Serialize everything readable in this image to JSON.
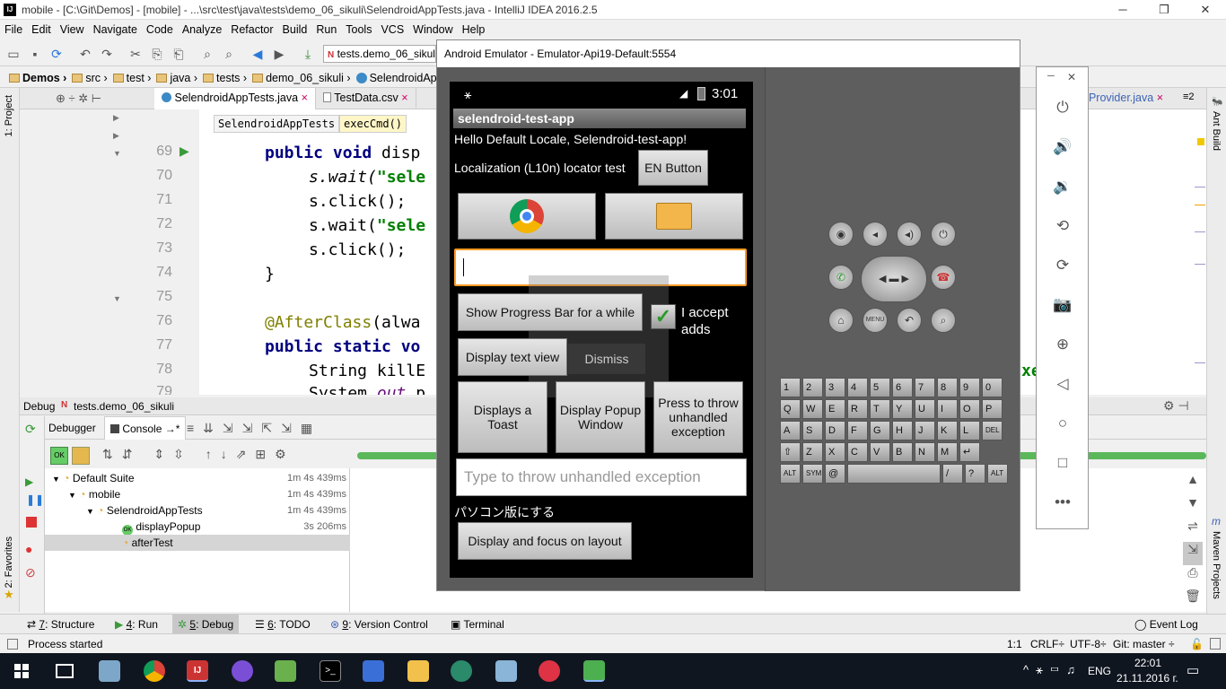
{
  "window": {
    "title": "mobile - [C:\\Git\\Demos] - [mobile] - ...\\src\\test\\java\\tests\\demo_06_sikuli\\SelendroidAppTests.java - IntelliJ IDEA 2016.2.5"
  },
  "menu": [
    "File",
    "Edit",
    "View",
    "Navigate",
    "Code",
    "Analyze",
    "Refactor",
    "Build",
    "Run",
    "Tools",
    "VCS",
    "Window",
    "Help"
  ],
  "toolbar": {
    "run_config": "tests.demo_06_sikul"
  },
  "breadcrumbs": [
    "Demos",
    "src",
    "test",
    "java",
    "tests",
    "demo_06_sikuli",
    "SelendroidApp"
  ],
  "editor": {
    "tabs": [
      "SelendroidAppTests.java",
      "TestData.csv",
      "aProvider.java"
    ],
    "hint_class": "SelendroidAppTests",
    "hint_method": "execCmd()",
    "line_numbers": [
      "69",
      "70",
      "71",
      "72",
      "73",
      "74",
      "75",
      "76",
      "77",
      "78",
      "79"
    ],
    "lines": [
      {
        "kw": "public void ",
        "rest": "disp"
      },
      {
        "pre": "s.wait(",
        "str": "\"sele"
      },
      {
        "pre": "s.click();"
      },
      {
        "pre": "s.wait(",
        "str": "\"sele"
      },
      {
        "pre": "s.click();"
      },
      {
        "pre": "}"
      },
      {
        "pre": ""
      },
      {
        "ann": "@AfterClass",
        "rest": "(alwa"
      },
      {
        "kw": "public static vo"
      },
      {
        "pre": "String killE",
        "right": "xe"
      },
      {
        "pre": "System.",
        "ital": "out",
        "rest": ".p"
      }
    ]
  },
  "debug": {
    "header": "Debug",
    "config": "tests.demo_06_sikuli",
    "tabs": [
      "Debugger",
      "Console"
    ],
    "tree": [
      {
        "label": "Default Suite",
        "time": "1m 4s 439ms"
      },
      {
        "label": "mobile",
        "time": "1m 4s 439ms"
      },
      {
        "label": "SelendroidAppTests",
        "time": "1m 4s 439ms"
      },
      {
        "label": "displayPopup",
        "time": "3s 206ms"
      },
      {
        "label": "afterTest",
        "time": ""
      }
    ]
  },
  "toolwindows": [
    {
      "num": "7",
      "label": "Structure"
    },
    {
      "num": "4",
      "label": "Run"
    },
    {
      "num": "5",
      "label": "Debug"
    },
    {
      "num": "6",
      "label": "TODO"
    },
    {
      "num": "9",
      "label": "Version Control"
    },
    {
      "num": "",
      "label": "Terminal"
    }
  ],
  "event_log": "Event Log",
  "status": {
    "message": "Process started",
    "position": "1:1",
    "line_sep": "CRLF÷",
    "encoding": "UTF-8÷",
    "git": "Git: master ÷"
  },
  "left_strip": {
    "project": "1: Project",
    "favorites": "2: Favorites"
  },
  "right_strip": {
    "ant": "Ant Build",
    "maven": "Maven Projects"
  },
  "emulator": {
    "title": "Android Emulator - Emulator-Api19-Default:5554",
    "clock": "3:01",
    "app_title": "selendroid-test-app",
    "hello": "Hello Default Locale, Selendroid-test-app!",
    "localization": "Localization (L10n) locator test",
    "en_button": "EN Button",
    "progress_button": "Show Progress Bar for a while",
    "accept_label": "I accept adds",
    "text_view_button": "Display text view",
    "dismiss": "Dismiss",
    "toast_button": "Displays a Toast",
    "popup_button": "Display Popup Window",
    "exception_button": "Press to throw unhandled exception",
    "exception_placeholder": "Type to throw unhandled exception",
    "japanese": "パソコン版にする",
    "focus_button": "Display and focus on layout",
    "keyboard_rows": [
      [
        "1",
        "2",
        "3",
        "4",
        "5",
        "6",
        "7",
        "8",
        "9",
        "0"
      ],
      [
        "Q",
        "W",
        "E",
        "R",
        "T",
        "Y",
        "U",
        "I",
        "O",
        "P"
      ],
      [
        "A",
        "S",
        "D",
        "F",
        "G",
        "H",
        "J",
        "K",
        "L",
        "DEL"
      ],
      [
        "⇧",
        "Z",
        "X",
        "C",
        "V",
        "B",
        "N",
        "M",
        "↵"
      ],
      [
        "ALT",
        "SYM",
        "@",
        "",
        "/",
        "?",
        "ALT"
      ]
    ]
  },
  "taskbar": {
    "time": "22:01",
    "date": "21.11.2016 г.",
    "lang": "ENG"
  }
}
